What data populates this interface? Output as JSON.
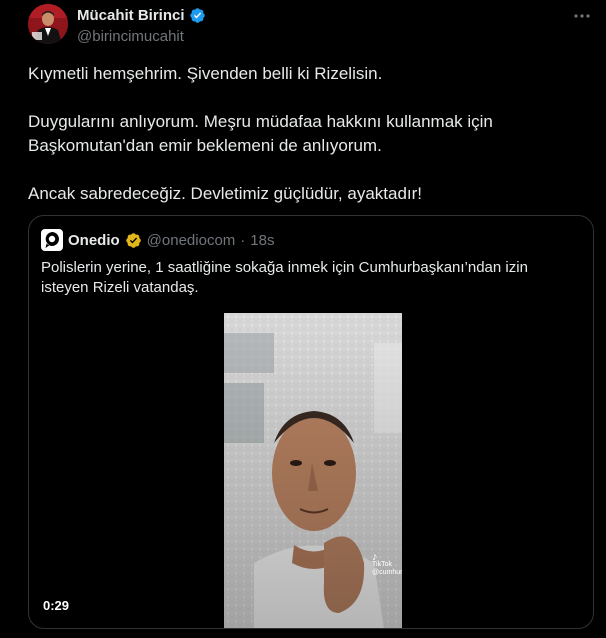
{
  "author": {
    "display_name": "Mücahit Birinci",
    "handle": "@birincimucahit",
    "verified": true,
    "verified_color": "#1d9bf0"
  },
  "tweet": {
    "paragraphs": [
      "Kıymetli hemşehrim. Şivenden belli ki Rizelisin.",
      "Duygularını anlıyorum. Meşru müdafaa hakkını kullanmak için Başkomutan'dan emir beklemeni de anlıyorum.",
      "Ancak sabredeceğiz. Devletimiz güçlüdür, ayaktadır!"
    ]
  },
  "quoted": {
    "display_name": "Onedio",
    "handle": "@onediocom",
    "separator": "·",
    "time": "18s",
    "verified_color": "#e2b719",
    "text": "Polislerin yerine, 1 saatliğine sokağa inmek için Cumhurbaşkanı’ndan izin isteyen Rizeli vatandaş.",
    "video": {
      "duration": "0:29",
      "watermark_brand": "TikTok",
      "watermark_handle": "@cumhuriyettvonline"
    }
  },
  "icons": {
    "more": "more-horizontal-icon",
    "verified": "verified-badge-icon"
  }
}
